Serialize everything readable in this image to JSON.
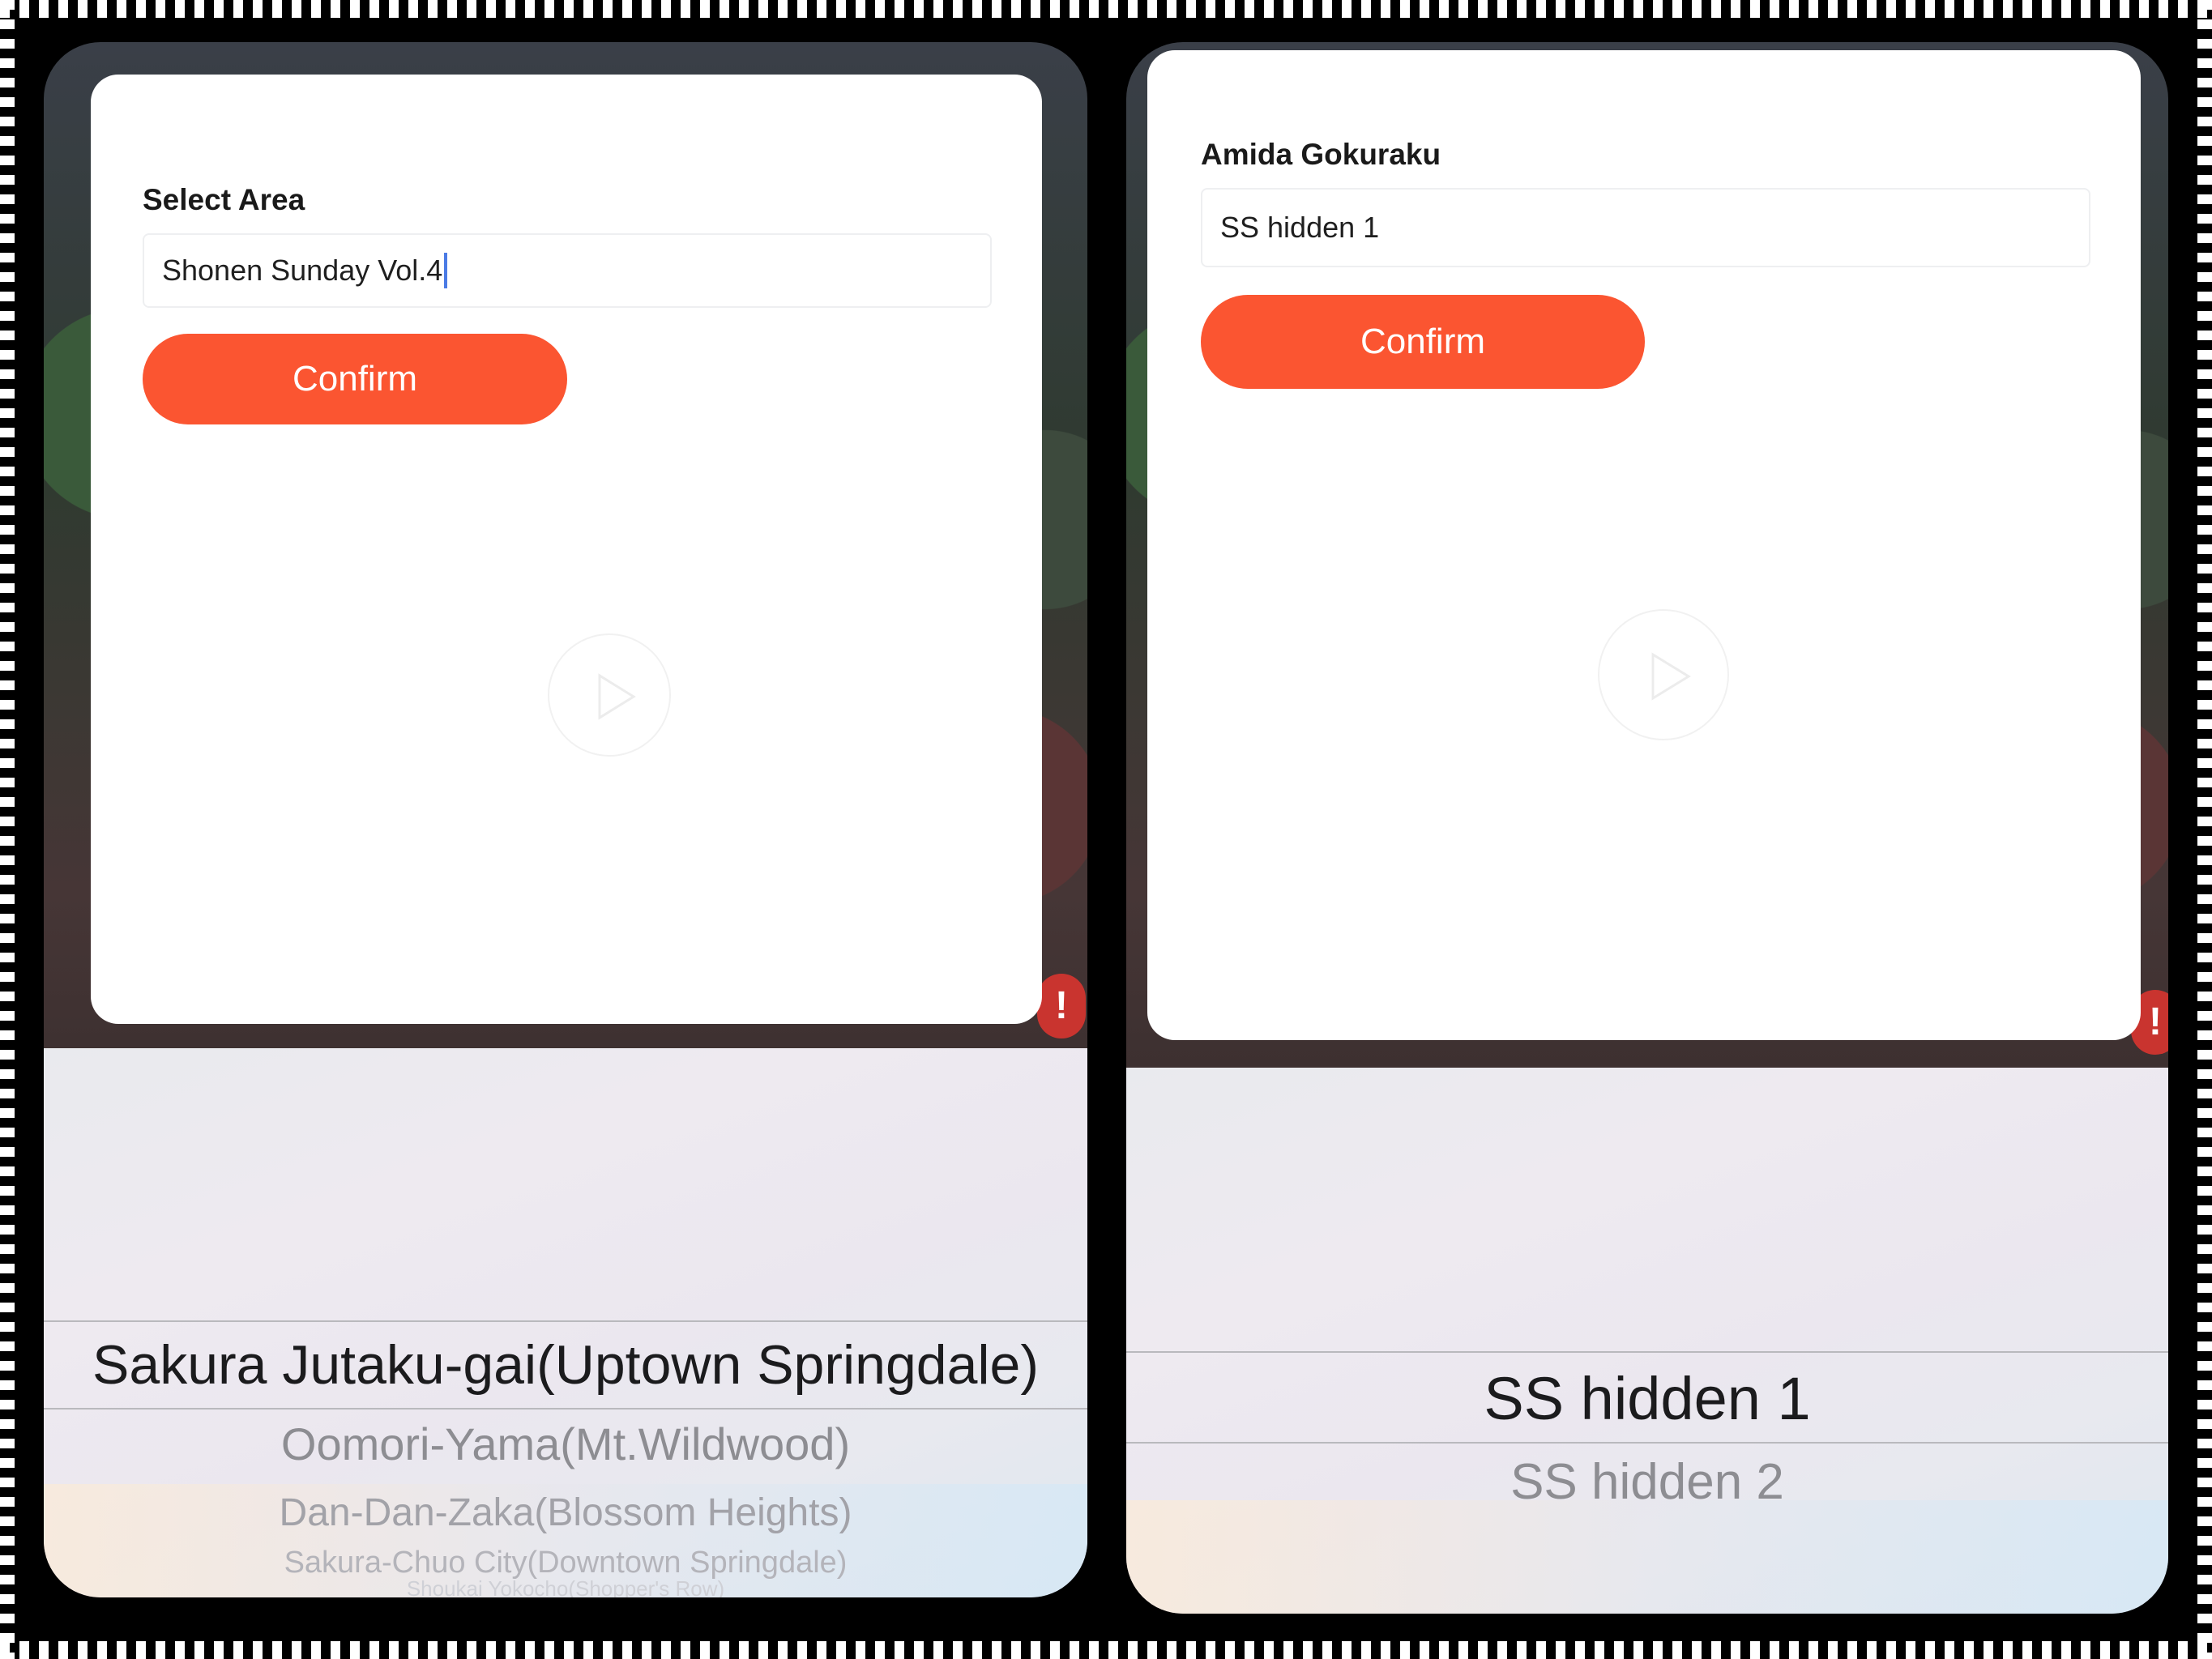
{
  "left_panel": {
    "label": "Select Area",
    "field_value": "Shonen Sunday Vol.4",
    "confirm_label": "Confirm",
    "picker": {
      "selected": "Sakura Jutaku-gai(Uptown Springdale)",
      "options_below": [
        "Oomori-Yama(Mt.Wildwood)",
        "Dan-Dan-Zaka(Blossom Heights)",
        "Sakura-Chuo City(Downtown Springdale)",
        "Shoukai Yokocho(Shopper's Row)"
      ]
    },
    "alert_badge": "!"
  },
  "right_panel": {
    "label": "Amida Gokuraku",
    "field_value": "SS hidden 1",
    "confirm_label": "Confirm",
    "picker": {
      "selected": "SS hidden 1",
      "options_below": [
        "SS hidden 2"
      ]
    },
    "alert_badge": "!"
  },
  "colors": {
    "confirm_button": "#fb5531",
    "caret": "#4b7be5"
  },
  "icons": [
    "play-icon",
    "alert-icon"
  ]
}
